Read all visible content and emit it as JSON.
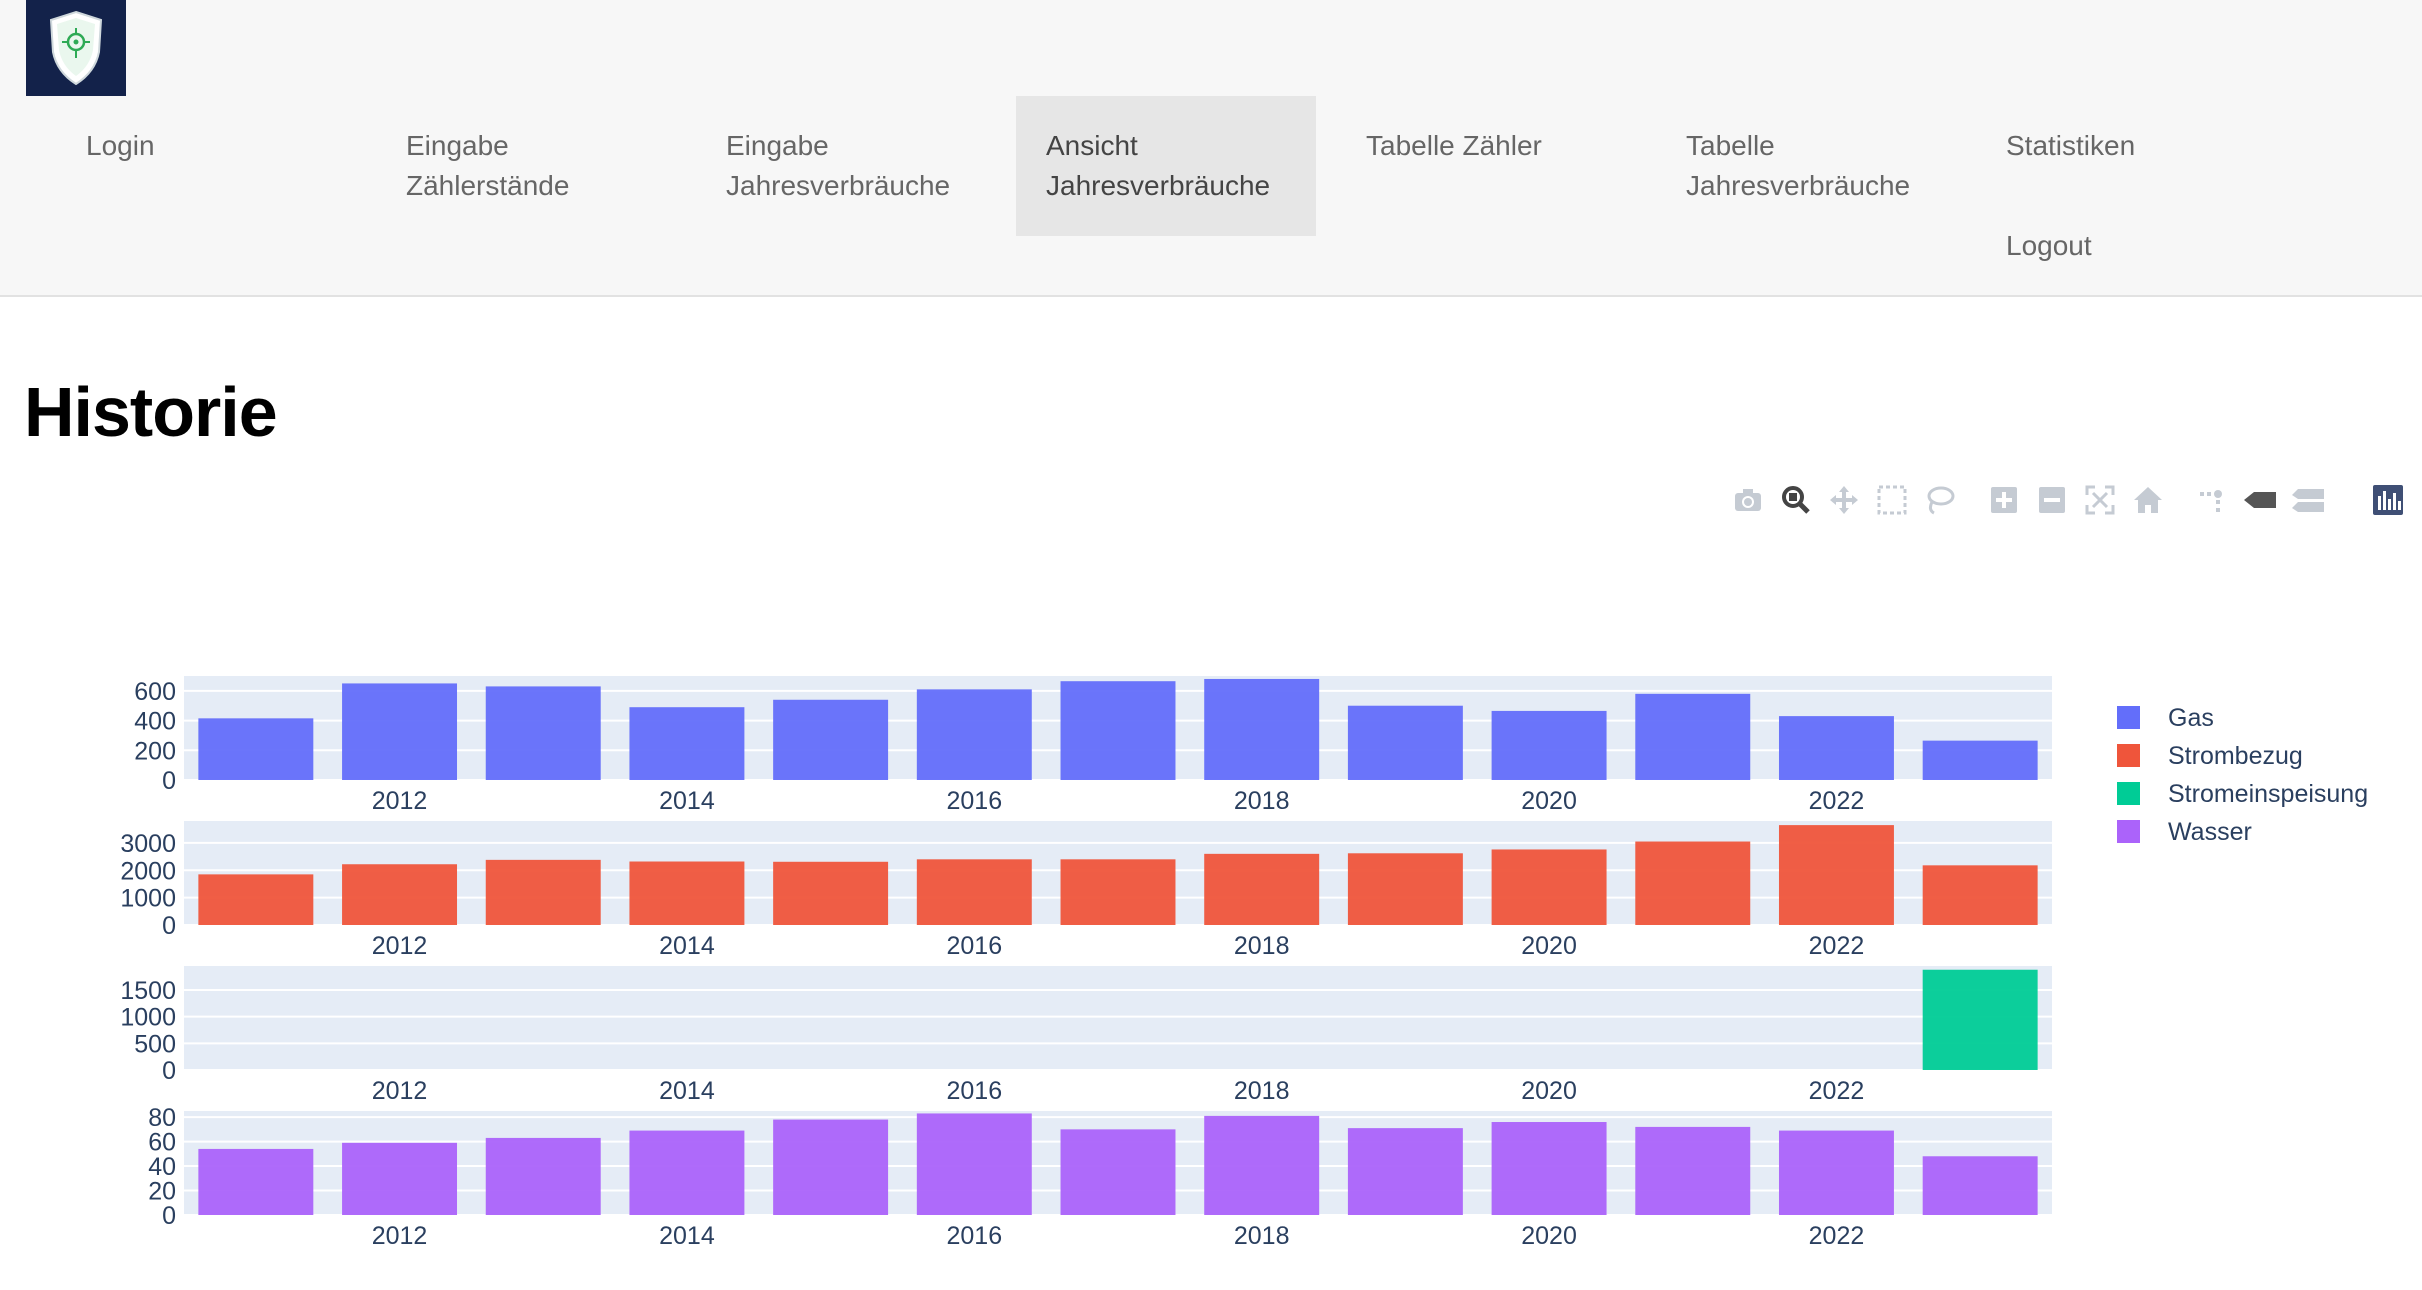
{
  "nav": {
    "items": [
      {
        "line1": "Login",
        "line2": ""
      },
      {
        "line1": "Eingabe",
        "line2": "Zählerstände"
      },
      {
        "line1": "Eingabe",
        "line2": "Jahresverbräuche"
      },
      {
        "line1": "Ansicht",
        "line2": "Jahresverbräuche"
      },
      {
        "line1": "Tabelle Zähler",
        "line2": ""
      },
      {
        "line1": "Tabelle",
        "line2": "Jahresverbräuche"
      },
      {
        "line1": "Statistiken",
        "line2": ""
      }
    ],
    "logout": "Logout",
    "active_index": 3
  },
  "page": {
    "title": "Historie"
  },
  "modebar": {
    "icons": [
      "camera-icon",
      "zoom-icon",
      "pan-icon",
      "box-select-icon",
      "lasso-select-icon",
      "zoom-in-icon",
      "zoom-out-icon",
      "autoscale-icon",
      "reset-axes-icon",
      "spike-lines-icon",
      "hover-closest-icon",
      "hover-compare-icon",
      "plotly-logo-icon"
    ]
  },
  "chart_data": {
    "type": "bar",
    "x": [
      2011,
      2012,
      2013,
      2014,
      2015,
      2016,
      2017,
      2018,
      2019,
      2020,
      2021,
      2022,
      2023
    ],
    "xtick_labels": [
      "2012",
      "2014",
      "2016",
      "2018",
      "2020",
      "2022"
    ],
    "series": [
      {
        "name": "Gas",
        "color": "#636efa",
        "values": [
          415,
          650,
          630,
          490,
          540,
          610,
          665,
          680,
          500,
          465,
          580,
          430,
          265
        ],
        "yticks": [
          0,
          200,
          400,
          600
        ],
        "ylim": [
          0,
          700
        ]
      },
      {
        "name": "Strombezug",
        "color": "#ef553b",
        "values": [
          1850,
          2220,
          2380,
          2320,
          2310,
          2400,
          2400,
          2600,
          2620,
          2760,
          3050,
          3650,
          2180
        ],
        "yticks": [
          0,
          1000,
          2000,
          3000
        ],
        "ylim": [
          0,
          3800
        ]
      },
      {
        "name": "Stromeinspeisung",
        "color": "#00cc96",
        "values": [
          0,
          0,
          0,
          0,
          0,
          0,
          0,
          0,
          0,
          0,
          0,
          0,
          1880
        ],
        "yticks": [
          0,
          500,
          1000,
          1500
        ],
        "ylim": [
          0,
          1950
        ]
      },
      {
        "name": "Wasser",
        "color": "#ab63fa",
        "values": [
          54,
          59,
          63,
          69,
          78,
          83,
          70,
          81,
          71,
          76,
          72,
          69,
          48
        ],
        "yticks": [
          0,
          20,
          40,
          60,
          80
        ],
        "ylim": [
          0,
          85
        ]
      }
    ],
    "legend_position": "right",
    "grid": true
  }
}
